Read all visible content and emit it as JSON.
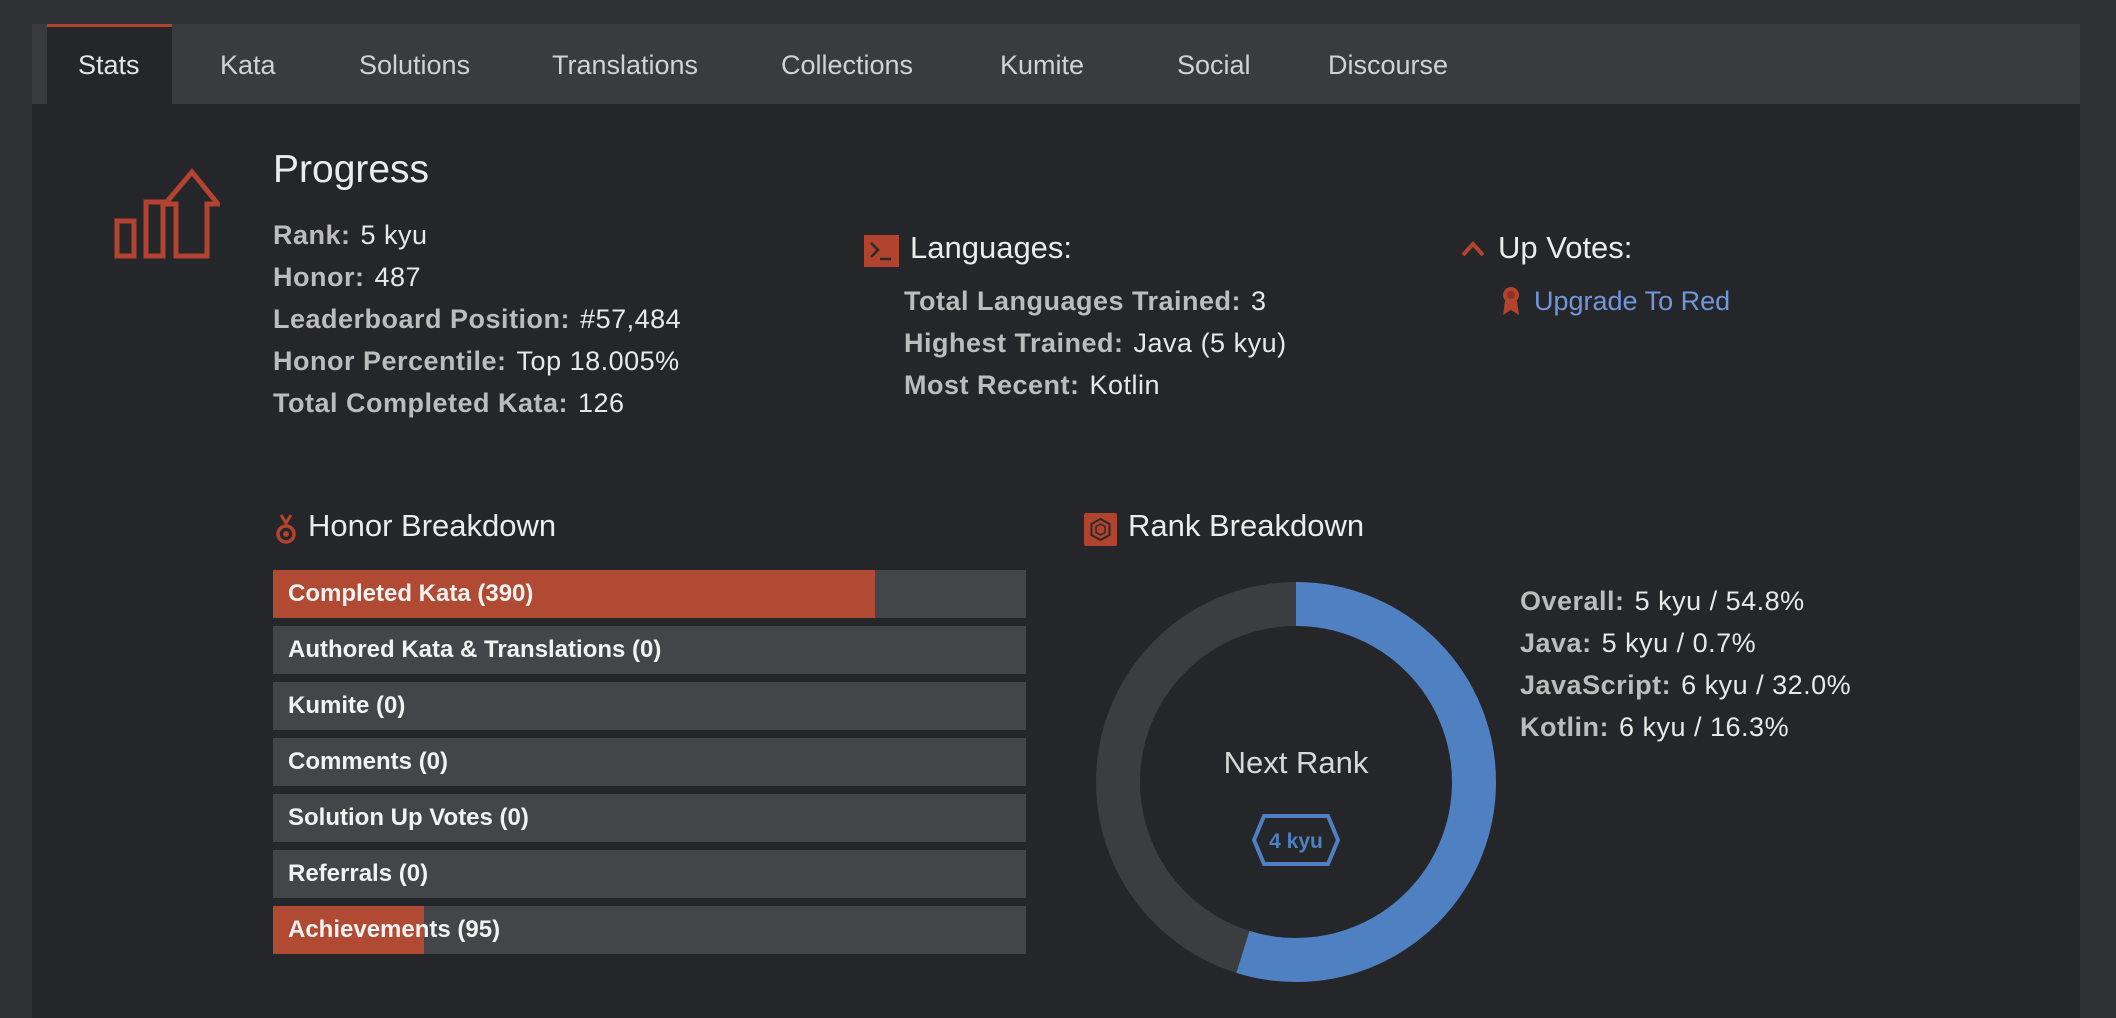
{
  "tabs": [
    {
      "label": "Stats",
      "active": true
    },
    {
      "label": "Kata"
    },
    {
      "label": "Solutions"
    },
    {
      "label": "Translations"
    },
    {
      "label": "Collections"
    },
    {
      "label": "Kumite"
    },
    {
      "label": "Social"
    },
    {
      "label": "Discourse"
    }
  ],
  "progress": {
    "title": "Progress",
    "icon": "progress-chart-icon",
    "rows": [
      {
        "label": "Rank:",
        "value": "5 kyu"
      },
      {
        "label": "Honor:",
        "value": "487"
      },
      {
        "label": "Leaderboard Position:",
        "value": "#57,484"
      },
      {
        "label": "Honor Percentile:",
        "value": "Top 18.005%"
      },
      {
        "label": "Total Completed Kata:",
        "value": "126"
      }
    ]
  },
  "languages": {
    "title": "Languages:",
    "icon": "terminal-icon",
    "rows": [
      {
        "label": "Total Languages Trained:",
        "value": "3"
      },
      {
        "label": "Highest Trained:",
        "value": "Java (5 kyu)"
      },
      {
        "label": "Most Recent:",
        "value": "Kotlin"
      }
    ]
  },
  "upvotes": {
    "title": "Up Votes:",
    "icon": "chevron-up-icon",
    "link_icon": "ribbon-icon",
    "link_label": "Upgrade To Red"
  },
  "honor_breakdown": {
    "title": "Honor Breakdown",
    "icon": "medal-icon",
    "bars": [
      {
        "label": "Completed Kata (390)",
        "fill": 0.8
      },
      {
        "label": "Authored Kata & Translations (0)",
        "fill": 0
      },
      {
        "label": "Kumite (0)",
        "fill": 0
      },
      {
        "label": "Comments (0)",
        "fill": 0
      },
      {
        "label": "Solution Up Votes (0)",
        "fill": 0
      },
      {
        "label": "Referrals (0)",
        "fill": 0
      },
      {
        "label": "Achievements (95)",
        "fill": 0.2
      }
    ]
  },
  "rank_breakdown": {
    "title": "Rank Breakdown",
    "icon": "hexagon-rank-icon",
    "donut_progress": 0.548,
    "center_label": "Next Rank",
    "next_rank_badge": "4 kyu",
    "rows": [
      {
        "label": "Overall:",
        "value": "5 kyu / 54.8%"
      },
      {
        "label": "Java:",
        "value": "5 kyu / 0.7%"
      },
      {
        "label": "JavaScript:",
        "value": "6 kyu / 32.0%"
      },
      {
        "label": "Kotlin:",
        "value": "6 kyu / 16.3%"
      }
    ]
  },
  "colors": {
    "accent": "#b1432f",
    "donut_fill": "#4e80c2",
    "donut_track": "#3c3d40",
    "link": "#6f97da"
  }
}
